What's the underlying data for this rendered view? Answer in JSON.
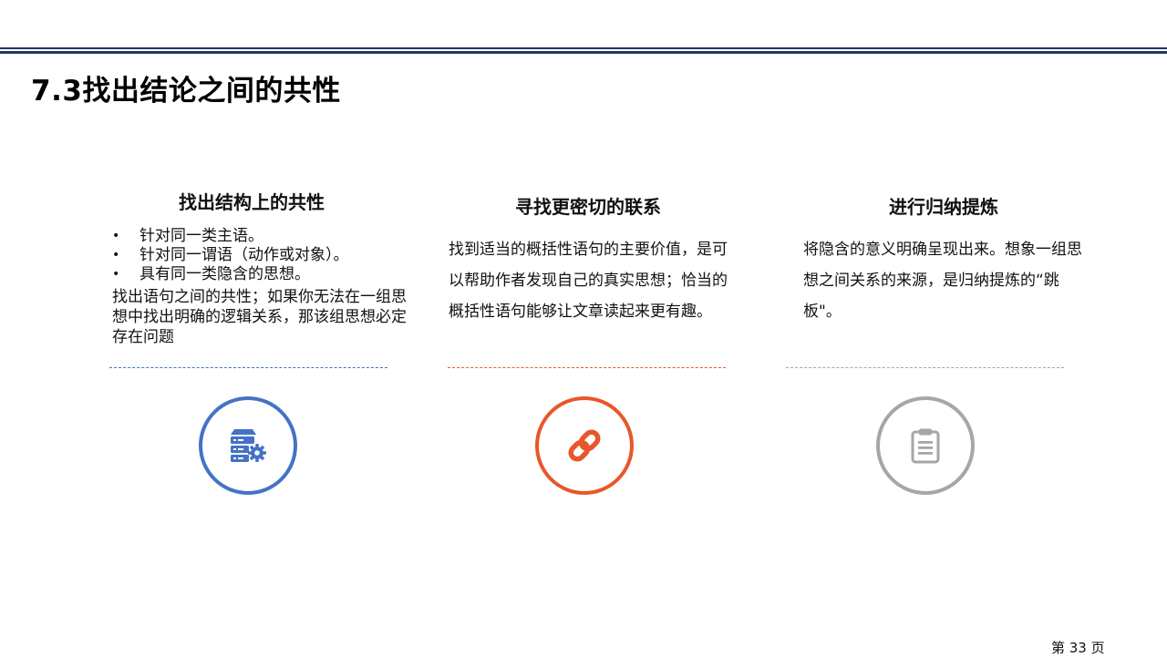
{
  "slide": {
    "title": "7.3找出结论之间的共性",
    "page_number": "第 33 页"
  },
  "columns": [
    {
      "heading": "找出结构上的共性",
      "bullets": [
        "针对同一类主语。",
        "针对同一谓语（动作或对象）。",
        "具有同一类隐含的思想。"
      ],
      "text": "找出语句之间的共性；如果你无法在一组思想中找出明确的逻辑关系，那该组思想必定存在问题",
      "icon": "server-gear-icon",
      "accent_color": "#4472c4"
    },
    {
      "heading": "寻找更密切的联系",
      "text": "找到适当的概括性语句的主要价值，是可以帮助作者发现自己的真实思想；恰当的概括性语句能够让文章读起来更有趣。",
      "icon": "link-icon",
      "accent_color": "#e8572a"
    },
    {
      "heading": "进行归纳提炼",
      "text": "将隐含的意义明确呈现出来。想象一组思想之间关系的来源，是归纳提炼的“跳板\"。",
      "icon": "clipboard-icon",
      "accent_color": "#a6a6a6"
    }
  ],
  "colors": {
    "header_rule": "#1f3864"
  }
}
